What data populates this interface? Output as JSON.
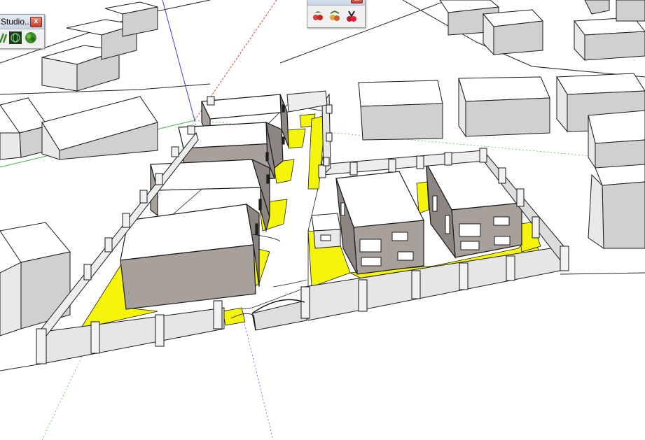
{
  "palettes": {
    "left": {
      "title": "Studio...",
      "close_label": "x",
      "icons": [
        "component-leaves-icon",
        "sphere-wireframe-icon",
        "bush-icon"
      ]
    },
    "top": {
      "close_label": "x",
      "icons": [
        "strawberry-plant-icon",
        "fruit-plant-icon",
        "red-tool-icon"
      ]
    }
  },
  "colors": {
    "background": "#ffffff",
    "ground_fill": "#f5f50a",
    "wall": "#e6e6e6",
    "roof": "#ffffff",
    "house_front": "#a7a09b",
    "house_side": "#8c8581",
    "edge": "#1a1a1a",
    "axis_red": "#e03c3c",
    "axis_green": "#3cb43c",
    "axis_blue": "#3c3ce0"
  }
}
